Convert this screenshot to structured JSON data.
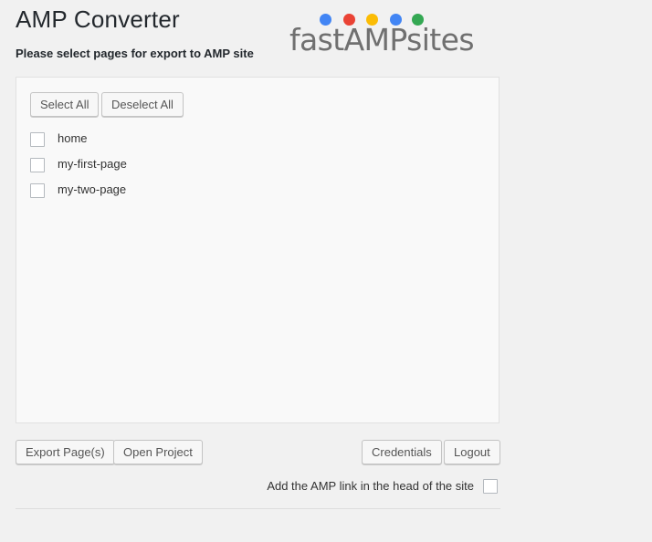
{
  "header": {
    "title": "AMP Converter",
    "subtitle": "Please select pages for export to AMP site"
  },
  "logo": {
    "text": "fastAMPsites",
    "dot_colors": [
      "#4285f4",
      "#ea4335",
      "#fbbc05",
      "#4285f4",
      "#34a853"
    ]
  },
  "panel": {
    "select_all_label": "Select All",
    "deselect_all_label": "Deselect All",
    "pages": [
      {
        "label": "home",
        "checked": false
      },
      {
        "label": "my-first-page",
        "checked": false
      },
      {
        "label": "my-two-page",
        "checked": false
      }
    ]
  },
  "actions": {
    "export_label": "Export Page(s)",
    "open_project_label": "Open Project",
    "credentials_label": "Credentials",
    "logout_label": "Logout"
  },
  "amp_link": {
    "label": "Add the AMP link in the head of the site",
    "checked": false
  }
}
